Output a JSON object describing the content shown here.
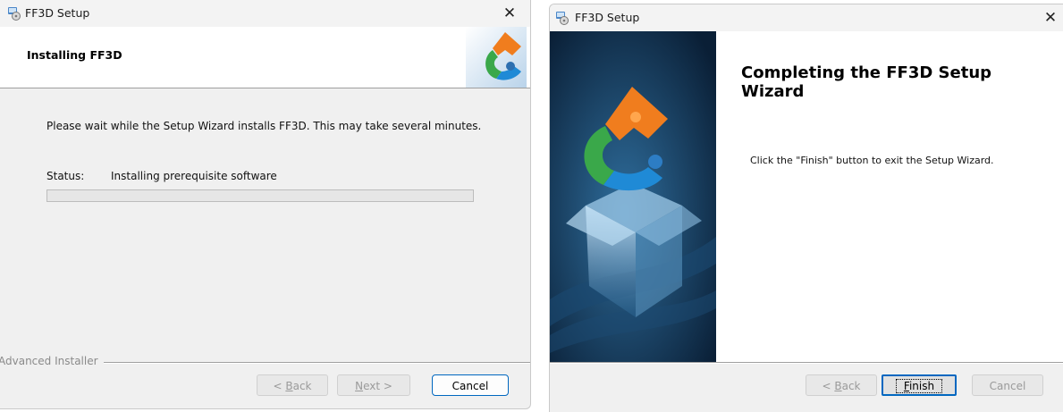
{
  "left_window": {
    "title": "FF3D Setup",
    "close_glyph": "✕",
    "header_title": "Installing FF3D",
    "header_logo": "ff3d-puzzle-logo",
    "description": "Please wait while the Setup Wizard installs FF3D.  This may take several minutes.",
    "status_label": "Status:",
    "status_value": "Installing prerequisite software",
    "progress": 0,
    "brand": "Advanced Installer",
    "buttons": {
      "back": {
        "prefix": "< ",
        "accel": "B",
        "rest": "ack"
      },
      "next": {
        "accel": "N",
        "rest": "ext >"
      },
      "cancel": "Cancel"
    }
  },
  "right_window": {
    "title": "FF3D Setup",
    "close_glyph": "✕",
    "side_image": "ff3d-box-puzzle-artwork",
    "heading": "Completing the FF3D Setup Wizard",
    "message": "Click the \"Finish\" button to exit the Setup Wizard.",
    "buttons": {
      "back": {
        "prefix": "< ",
        "accel": "B",
        "rest": "ack"
      },
      "finish": {
        "accel": "F",
        "rest": "inish"
      },
      "cancel": "Cancel"
    }
  },
  "colors": {
    "accent": "#0067c0",
    "panel_dark": "#0e2a45",
    "logo_orange": "#f07d1e",
    "logo_green": "#3aa84a",
    "logo_blue": "#1f8ad6"
  }
}
